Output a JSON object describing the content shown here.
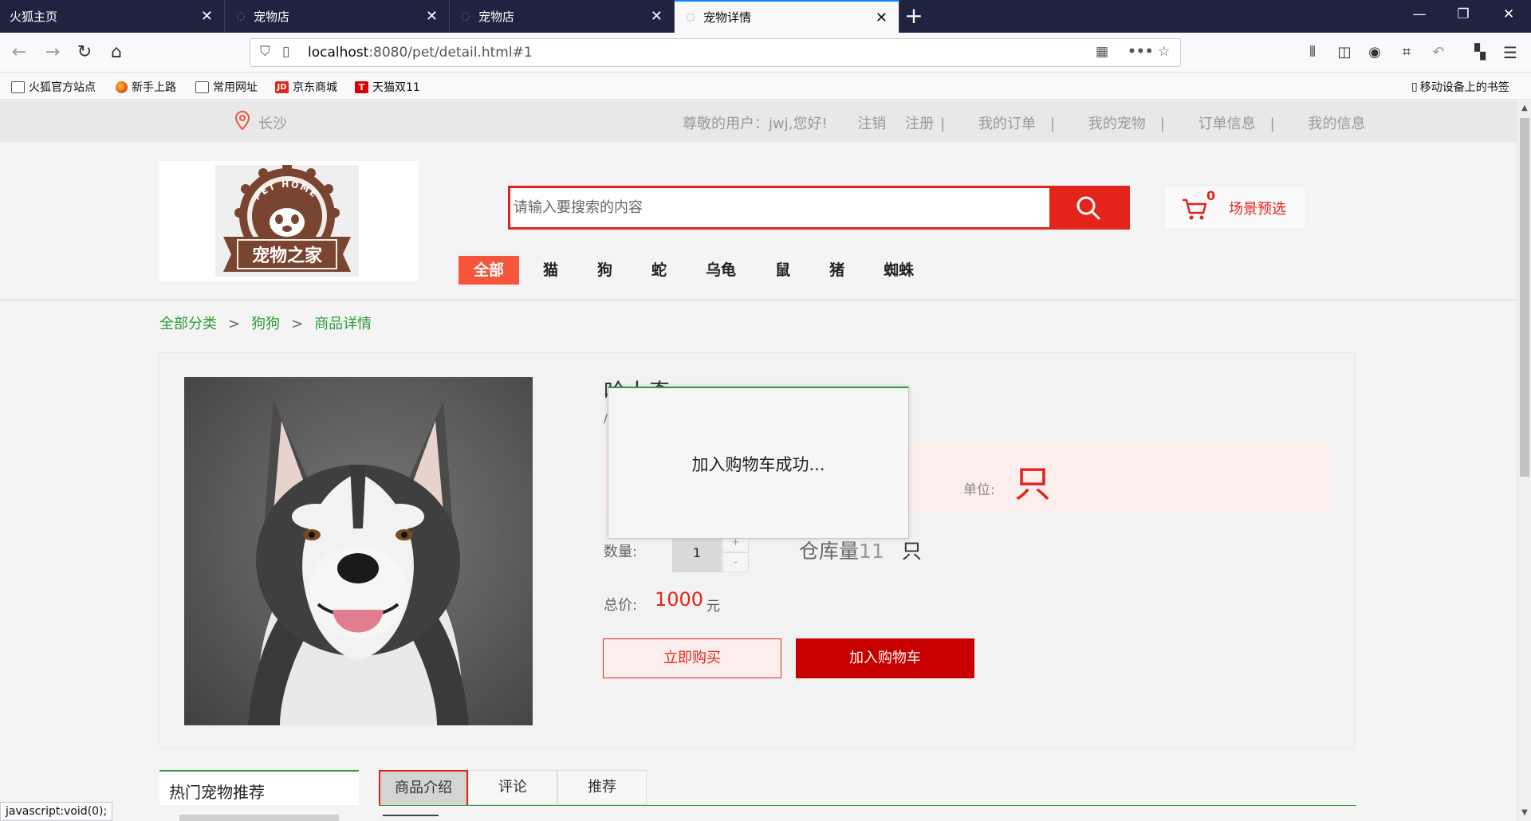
{
  "browser": {
    "tabs": [
      {
        "label": "火狐主页",
        "active": false
      },
      {
        "label": "宠物店",
        "active": false
      },
      {
        "label": "宠物店",
        "active": false
      },
      {
        "label": "宠物详情",
        "active": true
      }
    ],
    "url_host": "localhost",
    "url_rest": ":8080/pet/detail.html#1",
    "bookmarks": [
      {
        "label": "火狐官方站点",
        "icon": "folder-icon"
      },
      {
        "label": "新手上路",
        "icon": "firefox-icon"
      },
      {
        "label": "常用网址",
        "icon": "folder-icon"
      },
      {
        "label": "京东商城",
        "icon": "jd-icon"
      },
      {
        "label": "天猫双11",
        "icon": "tmall-icon"
      }
    ],
    "mobile_bookmarks": "移动设备上的书签",
    "status_text": "javascript:void(0);"
  },
  "site": {
    "location": "长沙",
    "user_links": {
      "greeting": "尊敬的用户：jwj,您好!",
      "logout": "注销",
      "register": "注册",
      "my_orders": "我的订单",
      "my_pets": "我的宠物",
      "order_info": "订单信息",
      "my_info": "我的信息"
    },
    "logo": {
      "arc_text": "PET HOME",
      "name": "宠物之家"
    },
    "search_placeholder": "请输入要搜索的内容",
    "cart": {
      "count": "0",
      "label": "场景预选"
    },
    "categories": [
      "全部",
      "猫",
      "狗",
      "蛇",
      "乌龟",
      "鼠",
      "猪",
      "蜘蛛"
    ]
  },
  "breadcrumb": [
    "全部分类",
    "狗狗",
    "商品详情"
  ],
  "product": {
    "name": "哈士奇",
    "unit_label": "单位:",
    "unit_value": "只",
    "qty_label": "数量:",
    "qty_value": "1",
    "qty_up": "+",
    "qty_down": "-",
    "stock_label": "仓库量",
    "stock_value": "11",
    "stock_unit": "只",
    "total_label": "总价:",
    "total_value": "1000",
    "total_unit": "元",
    "buy_now": "立即购买",
    "add_to_cart": "加入购物车"
  },
  "toast": {
    "message": "加入购物车成功..."
  },
  "sidebar": {
    "title": "热门宠物推荐"
  },
  "detail_tabs": [
    "商品介绍",
    "评论",
    "推荐"
  ],
  "colors": {
    "accent_red": "#e4231b",
    "brand_green": "#2e9c3a",
    "logo_brown": "#7a4530"
  }
}
